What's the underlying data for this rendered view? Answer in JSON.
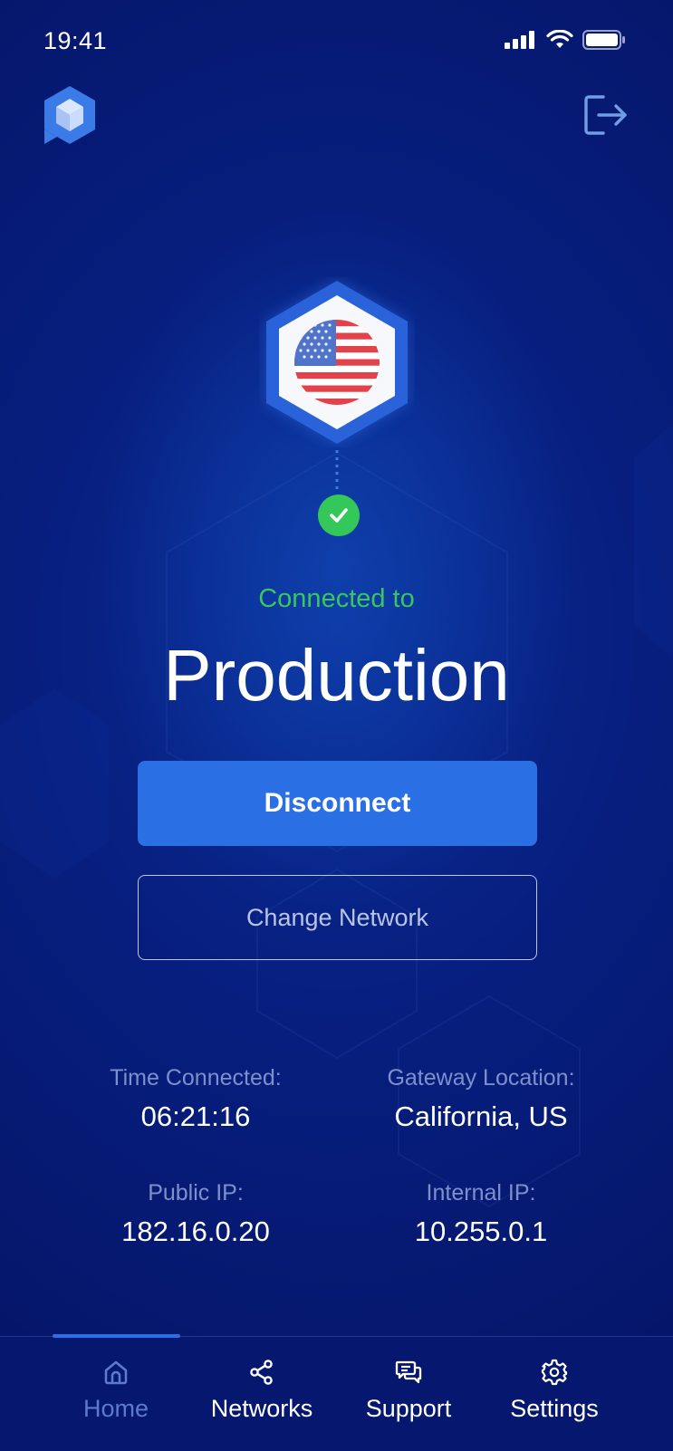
{
  "status_bar": {
    "time": "19:41"
  },
  "header": {
    "logo_icon": "cube-logo-icon",
    "logout_icon": "logout-icon"
  },
  "connection": {
    "flag_icon": "us-flag-icon",
    "status_icon": "check-icon",
    "status_label": "Connected to",
    "network_name": "Production"
  },
  "actions": {
    "disconnect_label": "Disconnect",
    "change_network_label": "Change Network"
  },
  "details": {
    "time_connected_label": "Time Connected:",
    "time_connected_value": "06:21:16",
    "gateway_location_label": "Gateway Location:",
    "gateway_location_value": "California, US",
    "public_ip_label": "Public IP:",
    "public_ip_value": "182.16.0.20",
    "internal_ip_label": "Internal IP:",
    "internal_ip_value": "10.255.0.1"
  },
  "tabbar": {
    "items": [
      {
        "label": "Home",
        "icon": "home-icon",
        "active": true
      },
      {
        "label": "Networks",
        "icon": "share-nodes-icon",
        "active": false
      },
      {
        "label": "Support",
        "icon": "chat-bubbles-icon",
        "active": false
      },
      {
        "label": "Settings",
        "icon": "gear-icon",
        "active": false
      }
    ]
  },
  "colors": {
    "background": "#071f80",
    "accent": "#2a6fe3",
    "success": "#39c65c",
    "tab_active": "#5b7ad0"
  }
}
